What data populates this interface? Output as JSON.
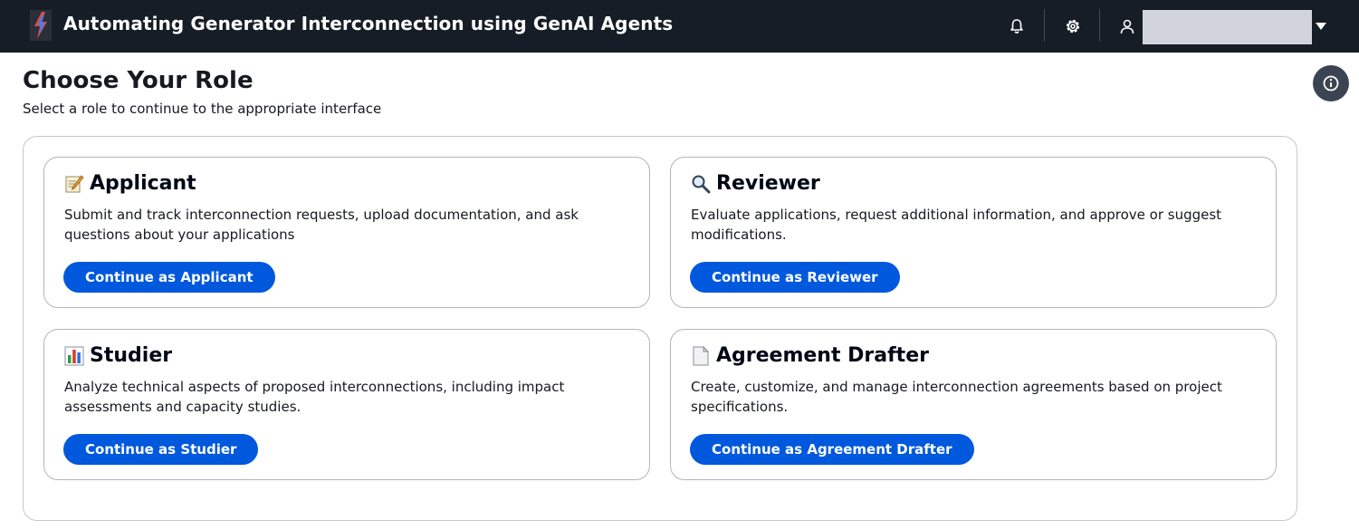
{
  "header": {
    "app_title": "Automating Generator Interconnection using GenAI Agents",
    "icons": [
      "lightning-logo-icon",
      "bell-icon",
      "gear-icon",
      "user-icon",
      "caret-down-icon"
    ]
  },
  "page": {
    "title": "Choose Your Role",
    "subtitle": "Select a role to continue to the appropriate interface"
  },
  "roles": [
    {
      "emoji": "memo-icon",
      "title": "Applicant",
      "description": "Submit and track interconnection requests, upload documentation, and ask questions about your applications",
      "button": "Continue as Applicant"
    },
    {
      "emoji": "magnifier-icon",
      "title": "Reviewer",
      "description": "Evaluate applications, request additional information, and approve or suggest modifications.",
      "button": "Continue as Reviewer"
    },
    {
      "emoji": "bar-chart-icon",
      "title": "Studier",
      "description": "Analyze technical aspects of proposed interconnections, including impact assessments and capacity studies.",
      "button": "Continue as Studier"
    },
    {
      "emoji": "document-icon",
      "title": "Agreement Drafter",
      "description": "Create, customize, and manage interconnection agreements based on project specifications.",
      "button": "Continue as Agreement Drafter"
    }
  ],
  "colors": {
    "header_bg": "#161d26",
    "primary_button": "#0058dd",
    "info_button": "#3a4452"
  }
}
